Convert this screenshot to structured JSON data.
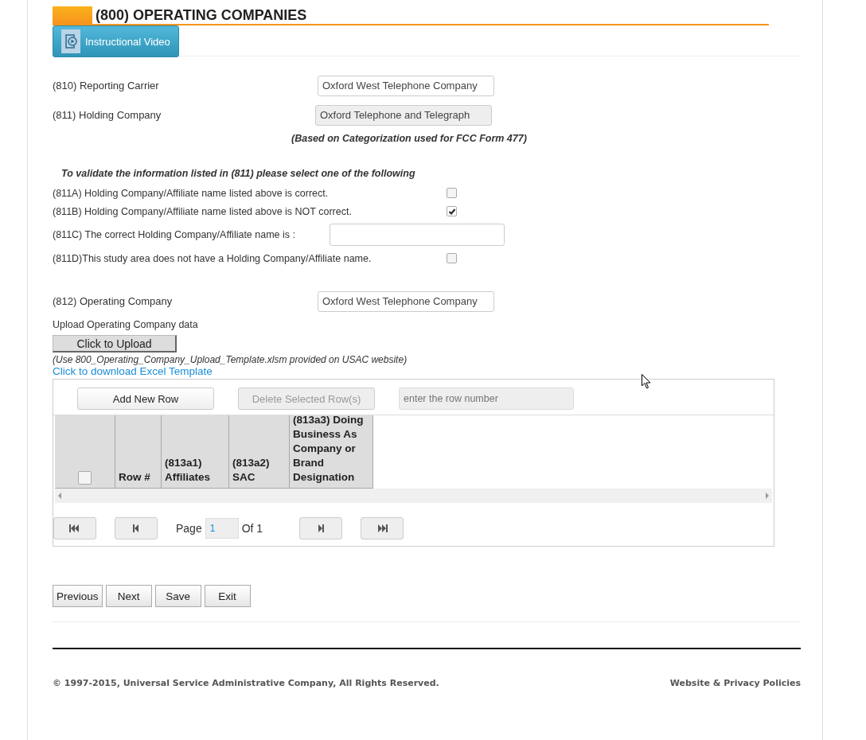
{
  "header": {
    "title": "(800) OPERATING COMPANIES",
    "video_button": "Instructional Video"
  },
  "fields": [
    {
      "label": "(810) Reporting Carrier",
      "value": "Oxford West Telephone Company",
      "disabled": false
    },
    {
      "label": "(811) Holding Company",
      "value": "Oxford Telephone and Telegraph",
      "disabled": true
    }
  ],
  "note": "(Based on Categorization used for FCC Form 477)",
  "validate_heading": "To validate the information listed in (811) please select one of the following",
  "options": [
    {
      "kind": "checkbox",
      "label": "(811A) Holding Company/Affiliate name listed above is correct.",
      "checked": false
    },
    {
      "kind": "checkbox",
      "label": "(811B) Holding Company/Affiliate name listed above is NOT correct.",
      "checked": true
    },
    {
      "kind": "text",
      "label": "(811C) The correct Holding Company/Affiliate name is :"
    },
    {
      "kind": "checkbox",
      "label": "(811D)This study area does not have a Holding Company/Affiliate name.",
      "checked": false
    }
  ],
  "operating_company": {
    "label": "(812) Operating Company",
    "value": "Oxford West Telephone Company"
  },
  "upload": {
    "label": "Upload Operating Company data",
    "button": "Click to Upload",
    "hint": "(Use 800_Operating_Company_Upload_Template.xlsm provided on USAC website)",
    "link": "Click to download Excel Template"
  },
  "grid": {
    "add_button": "Add New Row",
    "delete_button": "Delete Selected Row(s)",
    "row_placeholder": "enter the row number",
    "columns": [
      "Row #",
      "(813a1) Affiliates",
      "(813a2) SAC",
      "(813a3) Doing Business As Company or Brand Designation"
    ],
    "select_all_checked": false,
    "pager": {
      "page_label": "Page",
      "page": "1",
      "of": "Of 1"
    }
  },
  "buttons": [
    "Previous",
    "Next",
    "Save",
    "Exit"
  ],
  "footer": {
    "copyright": "© 1997-2015, Universal Service Administrative Company, All Rights Reserved.",
    "link": "Website & Privacy Policies"
  }
}
